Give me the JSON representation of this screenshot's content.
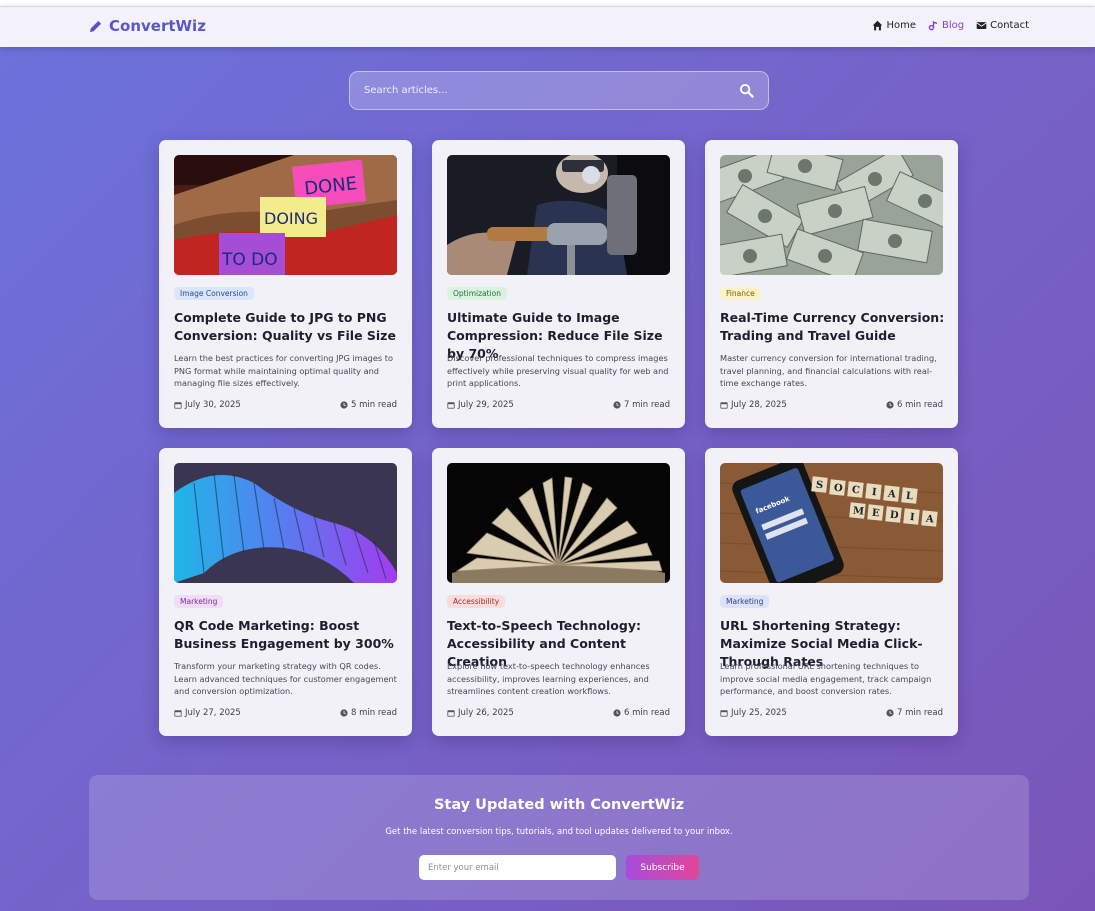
{
  "brand": {
    "name": "ConvertWiz",
    "icon": "pencil-icon"
  },
  "nav": [
    {
      "label": "Home",
      "icon": "home-icon",
      "active": false
    },
    {
      "label": "Blog",
      "icon": "blog-icon",
      "active": true
    },
    {
      "label": "Contact",
      "icon": "envelope-icon",
      "active": false
    }
  ],
  "search": {
    "placeholder": "Search articles...",
    "icon": "search-icon"
  },
  "colors": {
    "accent": "#5b55c8",
    "active_nav": "#8a3fd0",
    "subscribe_from": "#a84bdc",
    "subscribe_to": "#e0479a"
  },
  "articles": [
    {
      "image": "sticky-notes-photo",
      "category": "Image Conversion",
      "category_bg": "#dbe6fb",
      "category_color": "#2b4a9a",
      "title": "Complete Guide to JPG to PNG Conversion: Quality vs File Size",
      "excerpt": "Learn the best practices for converting JPG images to PNG format while maintaining optimal quality and managing file sizes effectively.",
      "date": "July 30, 2025",
      "read_time": "5 min read"
    },
    {
      "image": "camera-lens-photo",
      "category": "Optimization",
      "category_bg": "#d8f3df",
      "category_color": "#25733c",
      "title": "Ultimate Guide to Image Compression: Reduce File Size by 70%",
      "excerpt": "Discover professional techniques to compress images effectively while preserving visual quality for web and print applications.",
      "date": "July 29, 2025",
      "read_time": "7 min read"
    },
    {
      "image": "dollar-bills-photo",
      "category": "Finance",
      "category_bg": "#fbf2c6",
      "category_color": "#7a5c0e",
      "title": "Real-Time Currency Conversion: Trading and Travel Guide",
      "excerpt": "Master currency conversion for international trading, travel planning, and financial calculations with real-time exchange rates.",
      "date": "July 28, 2025",
      "read_time": "6 min read"
    },
    {
      "image": "abstract-swirl-photo",
      "category": "Marketing",
      "category_bg": "#efdcf7",
      "category_color": "#7a2f96",
      "title": "QR Code Marketing: Boost Business Engagement by 300%",
      "excerpt": "Transform your marketing strategy with QR codes. Learn advanced techniques for customer engagement and conversion optimization.",
      "date": "July 27, 2025",
      "read_time": "8 min read"
    },
    {
      "image": "open-book-photo",
      "category": "Accessibility",
      "category_bg": "#fbdcdc",
      "category_color": "#9a2f2f",
      "title": "Text-to-Speech Technology: Accessibility and Content Creation",
      "excerpt": "Explore how text-to-speech technology enhances accessibility, improves learning experiences, and streamlines content creation workflows.",
      "date": "July 26, 2025",
      "read_time": "6 min read"
    },
    {
      "image": "social-media-phone-photo",
      "category": "Marketing",
      "category_bg": "#dde3f7",
      "category_color": "#2d3f8c",
      "title": "URL Shortening Strategy: Maximize Social Media Click-Through Rates",
      "excerpt": "Learn professional URL shortening techniques to improve social media engagement, track campaign performance, and boost conversion rates.",
      "date": "July 25, 2025",
      "read_time": "7 min read"
    }
  ],
  "photo_text": {
    "sticky_notes": [
      "DONE",
      "DOING",
      "TO DO"
    ],
    "facebook": "facebook",
    "tiles": [
      "S",
      "O",
      "C",
      "I",
      "A",
      "L",
      "M",
      "E",
      "D",
      "I",
      "A"
    ]
  },
  "newsletter": {
    "title": "Stay Updated with ConvertWiz",
    "subtitle": "Get the latest conversion tips, tutorials, and tool updates delivered to your inbox.",
    "email_placeholder": "Enter your email",
    "button_label": "Subscribe"
  }
}
